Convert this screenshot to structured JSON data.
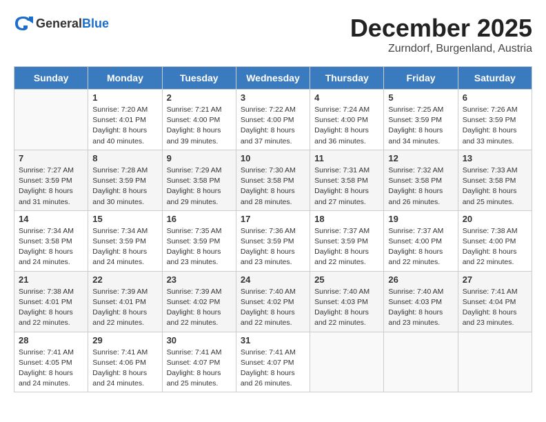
{
  "header": {
    "logo_general": "General",
    "logo_blue": "Blue",
    "month": "December 2025",
    "location": "Zurndorf, Burgenland, Austria"
  },
  "weekdays": [
    "Sunday",
    "Monday",
    "Tuesday",
    "Wednesday",
    "Thursday",
    "Friday",
    "Saturday"
  ],
  "weeks": [
    [
      {
        "day": "",
        "info": ""
      },
      {
        "day": "1",
        "info": "Sunrise: 7:20 AM\nSunset: 4:01 PM\nDaylight: 8 hours\nand 40 minutes."
      },
      {
        "day": "2",
        "info": "Sunrise: 7:21 AM\nSunset: 4:00 PM\nDaylight: 8 hours\nand 39 minutes."
      },
      {
        "day": "3",
        "info": "Sunrise: 7:22 AM\nSunset: 4:00 PM\nDaylight: 8 hours\nand 37 minutes."
      },
      {
        "day": "4",
        "info": "Sunrise: 7:24 AM\nSunset: 4:00 PM\nDaylight: 8 hours\nand 36 minutes."
      },
      {
        "day": "5",
        "info": "Sunrise: 7:25 AM\nSunset: 3:59 PM\nDaylight: 8 hours\nand 34 minutes."
      },
      {
        "day": "6",
        "info": "Sunrise: 7:26 AM\nSunset: 3:59 PM\nDaylight: 8 hours\nand 33 minutes."
      }
    ],
    [
      {
        "day": "7",
        "info": "Sunrise: 7:27 AM\nSunset: 3:59 PM\nDaylight: 8 hours\nand 31 minutes."
      },
      {
        "day": "8",
        "info": "Sunrise: 7:28 AM\nSunset: 3:59 PM\nDaylight: 8 hours\nand 30 minutes."
      },
      {
        "day": "9",
        "info": "Sunrise: 7:29 AM\nSunset: 3:58 PM\nDaylight: 8 hours\nand 29 minutes."
      },
      {
        "day": "10",
        "info": "Sunrise: 7:30 AM\nSunset: 3:58 PM\nDaylight: 8 hours\nand 28 minutes."
      },
      {
        "day": "11",
        "info": "Sunrise: 7:31 AM\nSunset: 3:58 PM\nDaylight: 8 hours\nand 27 minutes."
      },
      {
        "day": "12",
        "info": "Sunrise: 7:32 AM\nSunset: 3:58 PM\nDaylight: 8 hours\nand 26 minutes."
      },
      {
        "day": "13",
        "info": "Sunrise: 7:33 AM\nSunset: 3:58 PM\nDaylight: 8 hours\nand 25 minutes."
      }
    ],
    [
      {
        "day": "14",
        "info": "Sunrise: 7:34 AM\nSunset: 3:58 PM\nDaylight: 8 hours\nand 24 minutes."
      },
      {
        "day": "15",
        "info": "Sunrise: 7:34 AM\nSunset: 3:59 PM\nDaylight: 8 hours\nand 24 minutes."
      },
      {
        "day": "16",
        "info": "Sunrise: 7:35 AM\nSunset: 3:59 PM\nDaylight: 8 hours\nand 23 minutes."
      },
      {
        "day": "17",
        "info": "Sunrise: 7:36 AM\nSunset: 3:59 PM\nDaylight: 8 hours\nand 23 minutes."
      },
      {
        "day": "18",
        "info": "Sunrise: 7:37 AM\nSunset: 3:59 PM\nDaylight: 8 hours\nand 22 minutes."
      },
      {
        "day": "19",
        "info": "Sunrise: 7:37 AM\nSunset: 4:00 PM\nDaylight: 8 hours\nand 22 minutes."
      },
      {
        "day": "20",
        "info": "Sunrise: 7:38 AM\nSunset: 4:00 PM\nDaylight: 8 hours\nand 22 minutes."
      }
    ],
    [
      {
        "day": "21",
        "info": "Sunrise: 7:38 AM\nSunset: 4:01 PM\nDaylight: 8 hours\nand 22 minutes."
      },
      {
        "day": "22",
        "info": "Sunrise: 7:39 AM\nSunset: 4:01 PM\nDaylight: 8 hours\nand 22 minutes."
      },
      {
        "day": "23",
        "info": "Sunrise: 7:39 AM\nSunset: 4:02 PM\nDaylight: 8 hours\nand 22 minutes."
      },
      {
        "day": "24",
        "info": "Sunrise: 7:40 AM\nSunset: 4:02 PM\nDaylight: 8 hours\nand 22 minutes."
      },
      {
        "day": "25",
        "info": "Sunrise: 7:40 AM\nSunset: 4:03 PM\nDaylight: 8 hours\nand 22 minutes."
      },
      {
        "day": "26",
        "info": "Sunrise: 7:40 AM\nSunset: 4:03 PM\nDaylight: 8 hours\nand 23 minutes."
      },
      {
        "day": "27",
        "info": "Sunrise: 7:41 AM\nSunset: 4:04 PM\nDaylight: 8 hours\nand 23 minutes."
      }
    ],
    [
      {
        "day": "28",
        "info": "Sunrise: 7:41 AM\nSunset: 4:05 PM\nDaylight: 8 hours\nand 24 minutes."
      },
      {
        "day": "29",
        "info": "Sunrise: 7:41 AM\nSunset: 4:06 PM\nDaylight: 8 hours\nand 24 minutes."
      },
      {
        "day": "30",
        "info": "Sunrise: 7:41 AM\nSunset: 4:07 PM\nDaylight: 8 hours\nand 25 minutes."
      },
      {
        "day": "31",
        "info": "Sunrise: 7:41 AM\nSunset: 4:07 PM\nDaylight: 8 hours\nand 26 minutes."
      },
      {
        "day": "",
        "info": ""
      },
      {
        "day": "",
        "info": ""
      },
      {
        "day": "",
        "info": ""
      }
    ]
  ]
}
